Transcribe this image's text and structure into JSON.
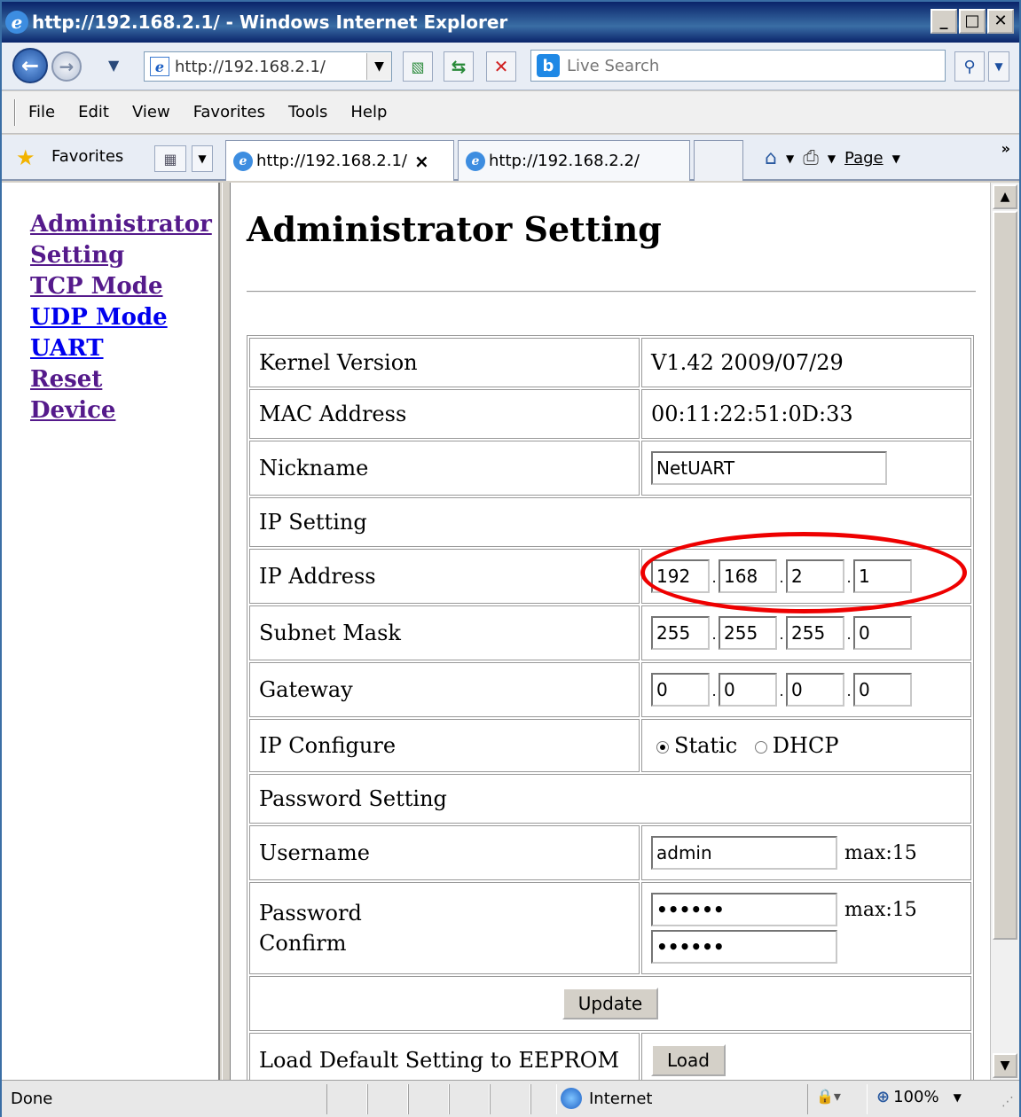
{
  "window": {
    "title": "http://192.168.2.1/ - Windows Internet Explorer",
    "min": "_",
    "max": "□",
    "close": "✕"
  },
  "address": {
    "url": "http://192.168.2.1/",
    "search_placeholder": "Live Search"
  },
  "menu": {
    "items": [
      "File",
      "Edit",
      "View",
      "Favorites",
      "Tools",
      "Help"
    ]
  },
  "favbar": {
    "favorites_label": "Favorites",
    "tabs": [
      {
        "label": "http://192.168.2.1/",
        "active": true
      },
      {
        "label": "http://192.168.2.2/",
        "active": false
      }
    ],
    "page_label": "Page"
  },
  "sidebar": {
    "links": [
      "Administrator Setting",
      "TCP Mode",
      "UDP Mode",
      "UART",
      "Reset",
      "Device"
    ]
  },
  "main": {
    "title": "Administrator Setting",
    "kernel_label": "Kernel Version",
    "kernel_value": "V1.42 2009/07/29",
    "mac_label": "MAC Address",
    "mac_value": "00:11:22:51:0D:33",
    "nickname_label": "Nickname",
    "nickname_value": "NetUART",
    "ip_setting_label": "IP Setting",
    "ip_label": "IP Address",
    "ip": [
      "192",
      "168",
      "2",
      "1"
    ],
    "subnet_label": "Subnet Mask",
    "subnet": [
      "255",
      "255",
      "255",
      "0"
    ],
    "gateway_label": "Gateway",
    "gateway": [
      "0",
      "0",
      "0",
      "0"
    ],
    "ipconf_label": "IP Configure",
    "static_label": "Static",
    "dhcp_label": "DHCP",
    "password_setting_label": "Password Setting",
    "username_label": "Username",
    "username_value": "admin",
    "max_label": "max:15",
    "password_label": "Password",
    "confirm_label": "Confirm",
    "password_value": "••••••",
    "update_label": "Update",
    "load_default_label": "Load Default Setting to EEPROM",
    "load_label": "Load"
  },
  "status": {
    "text": "Done",
    "zone": "Internet",
    "zoom": "100%"
  }
}
